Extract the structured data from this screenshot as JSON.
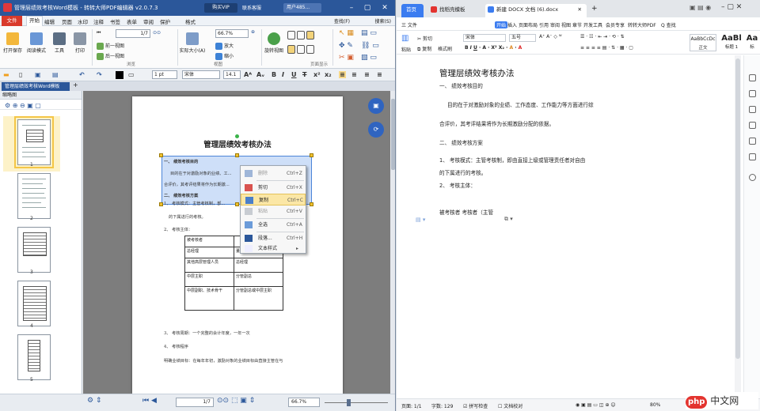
{
  "pdf": {
    "title": "管理层绩效考核Word模板 - 转转大师PDF编辑器 v2.0.7.3",
    "vip_label": "购买VIP",
    "service_label": "联系客服",
    "user_label": "用户485...",
    "menu": [
      "文件",
      "开始",
      "编辑",
      "页面",
      "水印",
      "注释",
      "书签",
      "表单",
      "审阅",
      "保护",
      "格式"
    ],
    "find_label": "查找(F)",
    "search_label": "搜索(S)",
    "ribbon": {
      "open_save": "打开保存",
      "read_mode": "阅读模式",
      "tools": "工具",
      "print": "打印",
      "page_input": "1/7",
      "prev_page": "前一视图",
      "next_page": "后一视图",
      "group_browse": "浏览",
      "zoom_value": "66.7%",
      "actual_size": "实际大小(A)",
      "zoom_in": "放大",
      "zoom_out": "缩小",
      "group_view": "视图",
      "rotate_view": "旋转视图",
      "group_page_display": "页面显示"
    },
    "fmt": {
      "line_width": "1 pt",
      "font_name": "宋体",
      "font_size": "14.1"
    },
    "doc_tab": "管理层绩效考核Word模板",
    "thumb_header": "缩略图",
    "page_numbers": [
      "1",
      "2",
      "3",
      "4",
      "5"
    ],
    "page": {
      "title": "管理层绩效考核办法",
      "lines": [
        "一、  绩效考核目的",
        "目的在于对激励对象的业绩、工...",
        "合评价，其考评结果将作为长期激...",
        "二、  绩效考核方案",
        "1、  考核模式：主管考核制，部...",
        "的下属进行的考核。",
        "2、  考核主体："
      ],
      "table": [
        [
          "被考核者",
          ""
        ],
        [
          "总经理",
          "董事会"
        ],
        [
          "其他高层管理人员",
          "总经理"
        ],
        [
          "中层主职",
          "分管副总"
        ],
        [
          "中层副职、技术骨干",
          "分管副总或中层主职"
        ]
      ],
      "lines_after": [
        "3、  考核周期：一个完整的会计年度，一年一次",
        "4、  考核程序",
        "明确业绩目标：在每年年初，激励对象的业绩目标由直接主管在与"
      ]
    },
    "context_menu": [
      {
        "label": "删除",
        "key": "Ctrl+Z",
        "enabled": false
      },
      {
        "label": "剪切",
        "key": "Ctrl+X",
        "enabled": true
      },
      {
        "label": "复制",
        "key": "Ctrl+C",
        "enabled": true
      },
      {
        "label": "粘贴",
        "key": "Ctrl+V",
        "enabled": false
      },
      {
        "label": "全选",
        "key": "Ctrl+A",
        "enabled": true
      },
      {
        "label": "段落...",
        "key": "Ctrl+H",
        "enabled": true
      },
      {
        "label": "文本样式",
        "key": "▸",
        "enabled": true
      }
    ],
    "status": {
      "page_value": "1/7",
      "zoom_value": "66.7%"
    }
  },
  "wps": {
    "tabs": [
      "首页",
      "找稻壳模板",
      "新建 DOCX 文档 (6).docx"
    ],
    "menu": [
      "三 文件",
      "开始",
      "插入",
      "页面布局",
      "引用",
      "审阅",
      "视图",
      "章节",
      "开发工具",
      "会员专享",
      "转转大师PDF",
      "Q 查找"
    ],
    "ribbon": {
      "paste": "粘贴",
      "cut": "剪切",
      "copy": "复制",
      "format_painter": "格式刷",
      "font_name": "宋体",
      "font_size": "五号",
      "style_normal_preview": "AaBbCcDc",
      "style_normal": "正文",
      "style_h1_preview": "AaBl",
      "style_h1": "标题 1",
      "style_h2_preview": "Aa",
      "style_h2": "标"
    },
    "doc": {
      "title": "管理层绩效考核办法",
      "lines": [
        "一、  绩效考核目的",
        "目的在于对激励对象的业绩、工作态度、工作能力等方面进行综",
        "合评价，其考评结果将作为长期激励分配的依据。",
        "二、  绩效考核方案",
        "1、  考核模式：主管考核制，即由直接上级或管理责任者对自由",
        "的下属进行的考核。",
        "2、  考核主体：",
        "被考核者  考核者（主管"
      ]
    },
    "status": {
      "page": "页面: 1/1",
      "words": "字数: 129",
      "spell": "拼写检查",
      "proof": "文档校对",
      "zoom": "80%"
    }
  },
  "watermark": {
    "brand": "php",
    "suffix": "中文网"
  }
}
